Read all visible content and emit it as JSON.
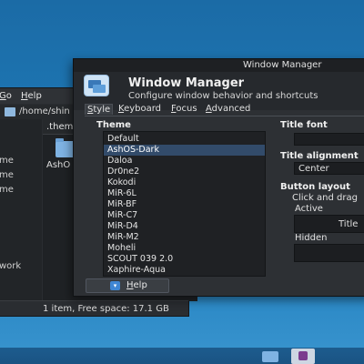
{
  "file_manager": {
    "menu": [
      {
        "prefix": "",
        "underline": "G",
        "rest": "o"
      },
      {
        "prefix": "",
        "underline": "H",
        "rest": "elp"
      }
    ],
    "path": "/home/shin",
    "sidebar_items": [
      "me",
      "me",
      "me",
      "work"
    ],
    "tab_label": ".them",
    "file_label": "AshO",
    "status": "1 item, Free space: 17.1 GB"
  },
  "window_manager": {
    "window_title": "Window Manager",
    "header_title": "Window Manager",
    "header_subtitle": "Configure window behavior and shortcuts",
    "tabs": [
      {
        "underline": "S",
        "rest": "tyle",
        "active": true
      },
      {
        "underline": "K",
        "rest": "eyboard",
        "active": false
      },
      {
        "underline": "F",
        "rest": "ocus",
        "active": false
      },
      {
        "underline": "A",
        "rest": "dvanced",
        "active": false
      }
    ],
    "theme_label": "Theme",
    "themes": [
      "Default",
      "AshOS-Dark",
      "Daloa",
      "Dr0ne2",
      "Kokodi",
      "MiR-6L",
      "MiR-BF",
      "MiR-C7",
      "MiR-D4",
      "MiR-M2",
      "Moheli",
      "SCOUT 039 2.0",
      "Xaphire-Aqua"
    ],
    "selected_theme": "AshOS-Dark",
    "title_font_label": "Title font",
    "title_alignment_label": "Title alignment",
    "title_alignment_value": "Center",
    "button_layout_label": "Button layout",
    "button_layout_hint": "Click and drag",
    "active_label": "Active",
    "active_field_text": "Title",
    "hidden_label": "Hidden",
    "help_button": {
      "underline": "H",
      "rest": "elp"
    }
  },
  "taskbar": {
    "icons": [
      "folder-icon",
      "window-manager-icon"
    ]
  },
  "colors": {
    "desktop": "#1e78b5",
    "window_bg": "#2d3034",
    "selection": "#324b6a"
  }
}
